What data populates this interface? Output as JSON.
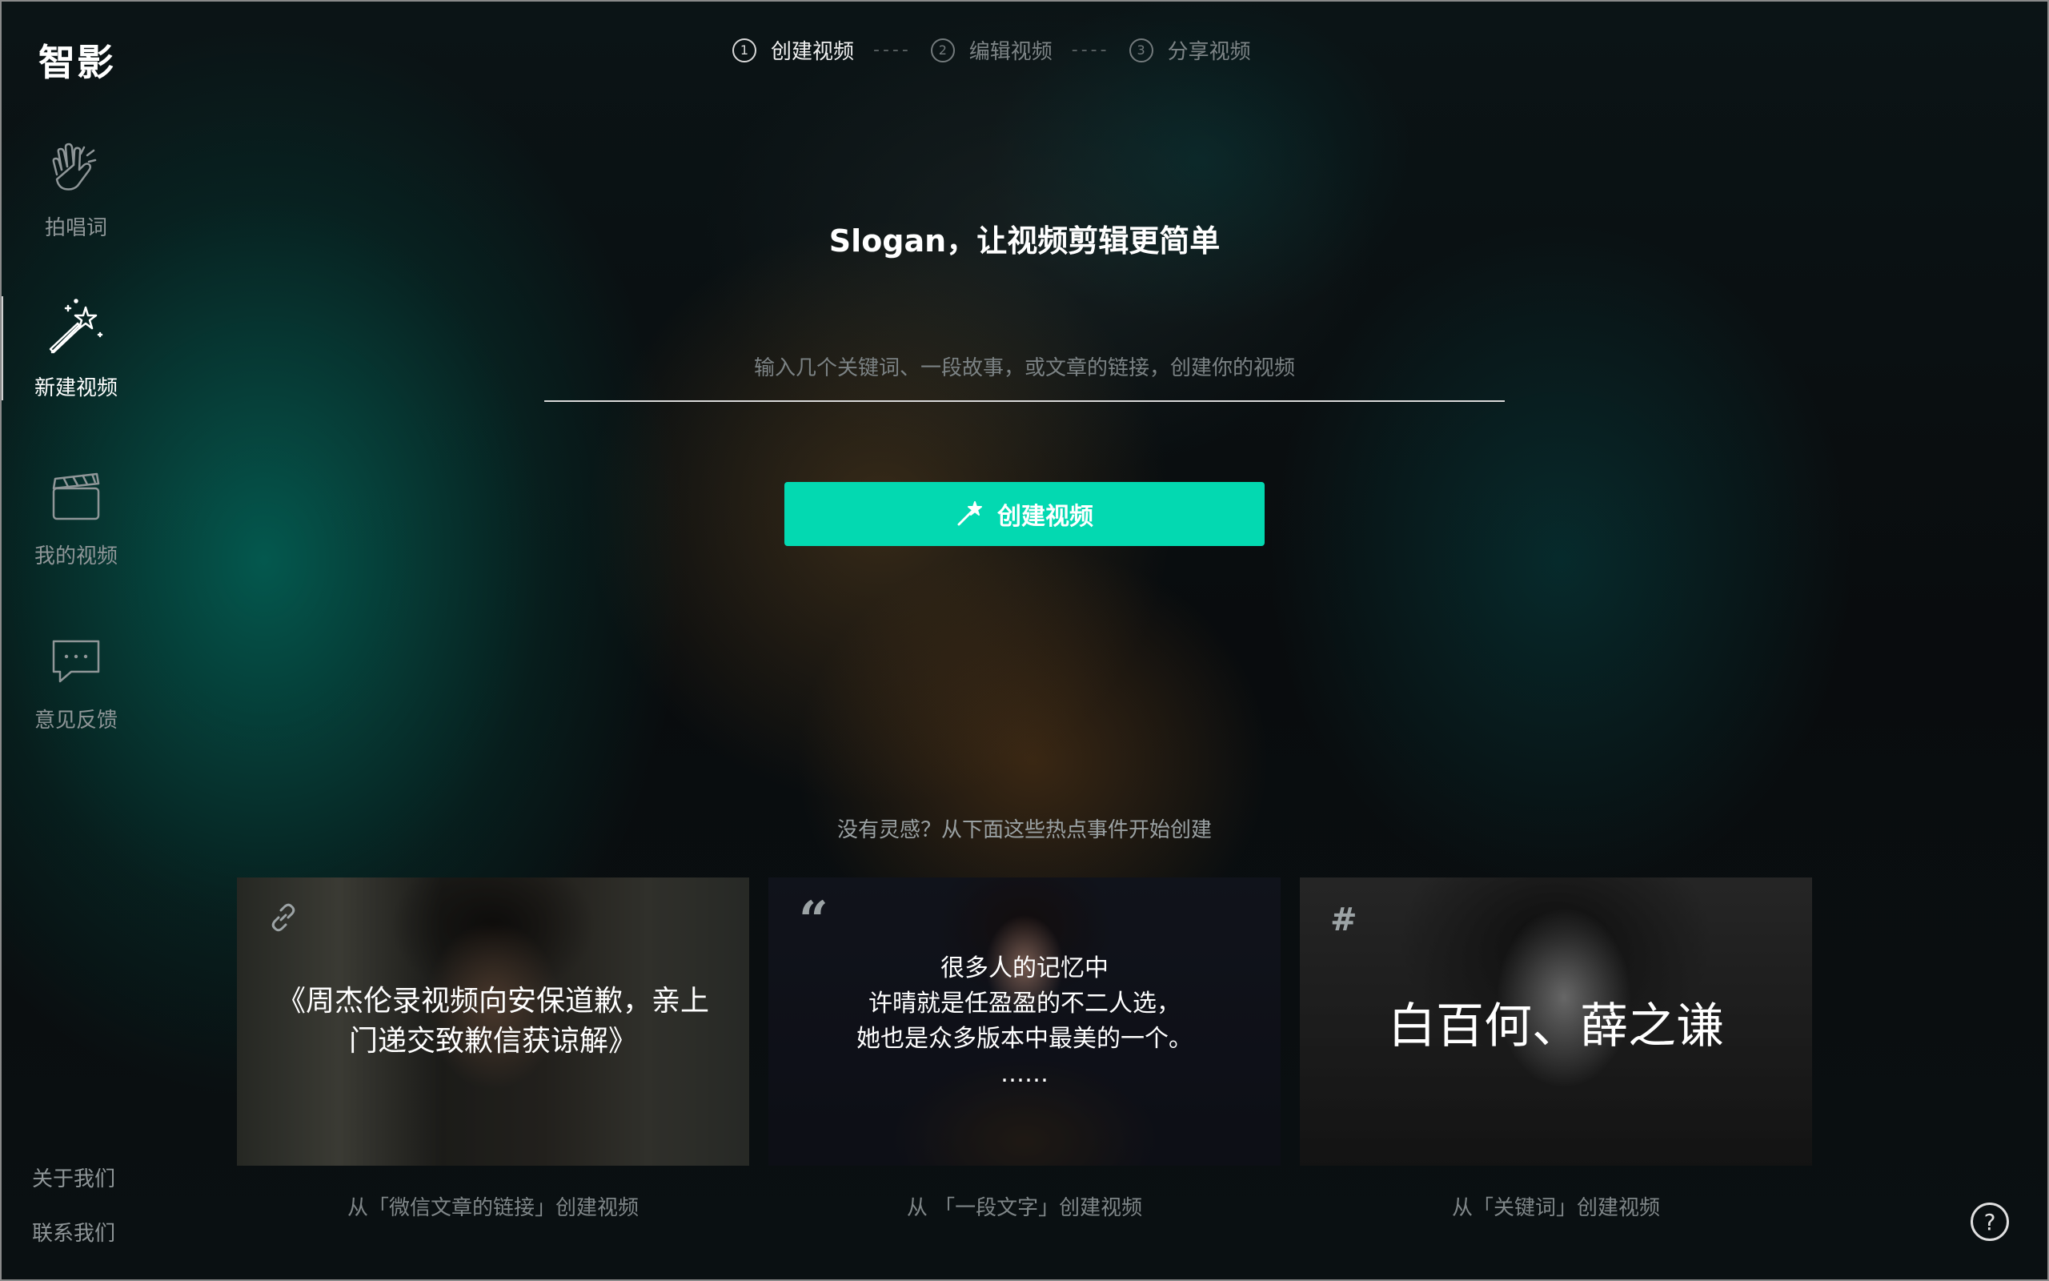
{
  "app": {
    "logo": "智影"
  },
  "sidebar": {
    "items": [
      {
        "label": "拍唱词",
        "icon": "clapping-hands-icon",
        "active": false
      },
      {
        "label": "新建视频",
        "icon": "magic-wand-icon",
        "active": true
      },
      {
        "label": "我的视频",
        "icon": "clapperboard-icon",
        "active": false
      },
      {
        "label": "意见反馈",
        "icon": "chat-bubble-icon",
        "active": false
      }
    ],
    "bottom_links": [
      "关于我们",
      "联系我们"
    ]
  },
  "steps": [
    {
      "num": "1",
      "label": "创建视频",
      "active": true
    },
    {
      "num": "2",
      "label": "编辑视频",
      "active": false
    },
    {
      "num": "3",
      "label": "分享视频",
      "active": false
    }
  ],
  "step_separator": "----",
  "main": {
    "slogan": "Slogan，让视频剪辑更简单",
    "input_placeholder": "输入几个关键词、一段故事，或文章的链接，创建你的视频",
    "input_value": "",
    "create_button": "创建视频",
    "hint": "没有灵感？从下面这些热点事件开始创建"
  },
  "cards": [
    {
      "corner": "🔗",
      "corner_icon": "link-icon",
      "text": "《周杰伦录视频向安保道歉，亲上门递交致歉信获谅解》",
      "caption": "从「微信文章的链接」创建视频"
    },
    {
      "corner": "“",
      "corner_icon": "quote-icon",
      "text": "很多人的记忆中 许晴就是任盈盈的不二人选， 她也是众多版本中最美的一个。 ……",
      "lines": [
        "很多人的记忆中",
        "许晴就是任盈盈的不二人选，",
        "她也是众多版本中最美的一个。",
        "……"
      ],
      "caption": "从 「一段文字」创建视频"
    },
    {
      "corner": "#",
      "corner_icon": "hashtag-icon",
      "text": "白百何、薛之谦",
      "caption": "从「关键词」创建视频"
    }
  ],
  "help": {
    "label": "?"
  },
  "colors": {
    "accent": "#03d9b1",
    "text_dim": "#8f9698"
  }
}
